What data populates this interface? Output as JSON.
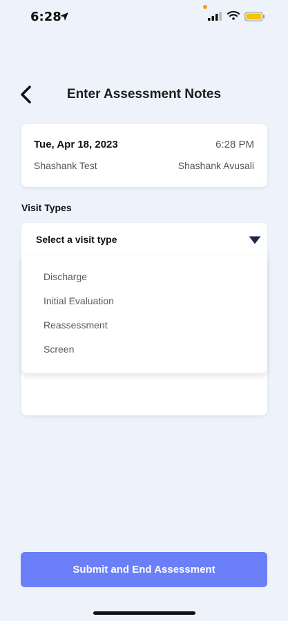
{
  "status_bar": {
    "time": "6:28",
    "icons": [
      "location-arrow-icon",
      "signal-icon",
      "wifi-icon",
      "battery-icon"
    ]
  },
  "header": {
    "title": "Enter Assessment Notes",
    "back_icon": "chevron-left-icon"
  },
  "session": {
    "date": "Tue, Apr 18, 2023",
    "time": "6:28 PM",
    "patient": "Shashank Test",
    "clinician": "Shashank Avusali"
  },
  "visit_types": {
    "label": "Visit Types",
    "placeholder": "Select a visit type",
    "caret_icon": "triangle-down-icon",
    "options": [
      "Discharge",
      "Initial Evaluation",
      "Reassessment",
      "Screen"
    ]
  },
  "actions": {
    "submit_label": "Submit and End Assessment"
  },
  "colors": {
    "background": "#eef3fb",
    "accent": "#6a7ff8",
    "caret": "#1f2747",
    "battery": "#f5c400",
    "status_dot": "#f39a1e"
  }
}
